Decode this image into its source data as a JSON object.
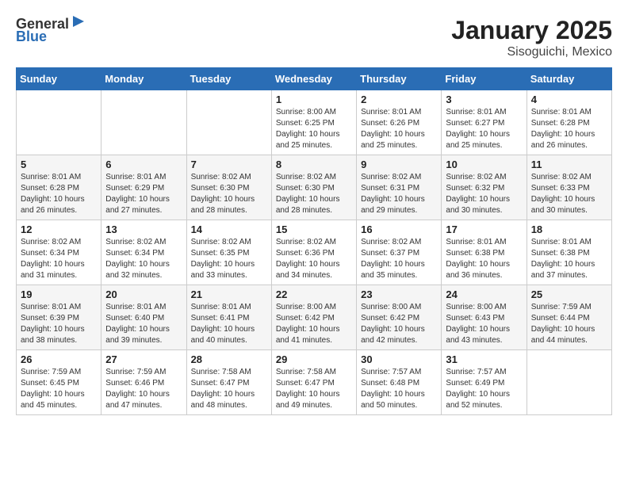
{
  "header": {
    "logo_line1": "General",
    "logo_line2": "Blue",
    "title": "January 2025",
    "subtitle": "Sisoguichi, Mexico"
  },
  "days_of_week": [
    "Sunday",
    "Monday",
    "Tuesday",
    "Wednesday",
    "Thursday",
    "Friday",
    "Saturday"
  ],
  "weeks": [
    [
      {
        "day": "",
        "info": ""
      },
      {
        "day": "",
        "info": ""
      },
      {
        "day": "",
        "info": ""
      },
      {
        "day": "1",
        "info": "Sunrise: 8:00 AM\nSunset: 6:25 PM\nDaylight: 10 hours\nand 25 minutes."
      },
      {
        "day": "2",
        "info": "Sunrise: 8:01 AM\nSunset: 6:26 PM\nDaylight: 10 hours\nand 25 minutes."
      },
      {
        "day": "3",
        "info": "Sunrise: 8:01 AM\nSunset: 6:27 PM\nDaylight: 10 hours\nand 25 minutes."
      },
      {
        "day": "4",
        "info": "Sunrise: 8:01 AM\nSunset: 6:28 PM\nDaylight: 10 hours\nand 26 minutes."
      }
    ],
    [
      {
        "day": "5",
        "info": "Sunrise: 8:01 AM\nSunset: 6:28 PM\nDaylight: 10 hours\nand 26 minutes."
      },
      {
        "day": "6",
        "info": "Sunrise: 8:01 AM\nSunset: 6:29 PM\nDaylight: 10 hours\nand 27 minutes."
      },
      {
        "day": "7",
        "info": "Sunrise: 8:02 AM\nSunset: 6:30 PM\nDaylight: 10 hours\nand 28 minutes."
      },
      {
        "day": "8",
        "info": "Sunrise: 8:02 AM\nSunset: 6:30 PM\nDaylight: 10 hours\nand 28 minutes."
      },
      {
        "day": "9",
        "info": "Sunrise: 8:02 AM\nSunset: 6:31 PM\nDaylight: 10 hours\nand 29 minutes."
      },
      {
        "day": "10",
        "info": "Sunrise: 8:02 AM\nSunset: 6:32 PM\nDaylight: 10 hours\nand 30 minutes."
      },
      {
        "day": "11",
        "info": "Sunrise: 8:02 AM\nSunset: 6:33 PM\nDaylight: 10 hours\nand 30 minutes."
      }
    ],
    [
      {
        "day": "12",
        "info": "Sunrise: 8:02 AM\nSunset: 6:34 PM\nDaylight: 10 hours\nand 31 minutes."
      },
      {
        "day": "13",
        "info": "Sunrise: 8:02 AM\nSunset: 6:34 PM\nDaylight: 10 hours\nand 32 minutes."
      },
      {
        "day": "14",
        "info": "Sunrise: 8:02 AM\nSunset: 6:35 PM\nDaylight: 10 hours\nand 33 minutes."
      },
      {
        "day": "15",
        "info": "Sunrise: 8:02 AM\nSunset: 6:36 PM\nDaylight: 10 hours\nand 34 minutes."
      },
      {
        "day": "16",
        "info": "Sunrise: 8:02 AM\nSunset: 6:37 PM\nDaylight: 10 hours\nand 35 minutes."
      },
      {
        "day": "17",
        "info": "Sunrise: 8:01 AM\nSunset: 6:38 PM\nDaylight: 10 hours\nand 36 minutes."
      },
      {
        "day": "18",
        "info": "Sunrise: 8:01 AM\nSunset: 6:38 PM\nDaylight: 10 hours\nand 37 minutes."
      }
    ],
    [
      {
        "day": "19",
        "info": "Sunrise: 8:01 AM\nSunset: 6:39 PM\nDaylight: 10 hours\nand 38 minutes."
      },
      {
        "day": "20",
        "info": "Sunrise: 8:01 AM\nSunset: 6:40 PM\nDaylight: 10 hours\nand 39 minutes."
      },
      {
        "day": "21",
        "info": "Sunrise: 8:01 AM\nSunset: 6:41 PM\nDaylight: 10 hours\nand 40 minutes."
      },
      {
        "day": "22",
        "info": "Sunrise: 8:00 AM\nSunset: 6:42 PM\nDaylight: 10 hours\nand 41 minutes."
      },
      {
        "day": "23",
        "info": "Sunrise: 8:00 AM\nSunset: 6:42 PM\nDaylight: 10 hours\nand 42 minutes."
      },
      {
        "day": "24",
        "info": "Sunrise: 8:00 AM\nSunset: 6:43 PM\nDaylight: 10 hours\nand 43 minutes."
      },
      {
        "day": "25",
        "info": "Sunrise: 7:59 AM\nSunset: 6:44 PM\nDaylight: 10 hours\nand 44 minutes."
      }
    ],
    [
      {
        "day": "26",
        "info": "Sunrise: 7:59 AM\nSunset: 6:45 PM\nDaylight: 10 hours\nand 45 minutes."
      },
      {
        "day": "27",
        "info": "Sunrise: 7:59 AM\nSunset: 6:46 PM\nDaylight: 10 hours\nand 47 minutes."
      },
      {
        "day": "28",
        "info": "Sunrise: 7:58 AM\nSunset: 6:47 PM\nDaylight: 10 hours\nand 48 minutes."
      },
      {
        "day": "29",
        "info": "Sunrise: 7:58 AM\nSunset: 6:47 PM\nDaylight: 10 hours\nand 49 minutes."
      },
      {
        "day": "30",
        "info": "Sunrise: 7:57 AM\nSunset: 6:48 PM\nDaylight: 10 hours\nand 50 minutes."
      },
      {
        "day": "31",
        "info": "Sunrise: 7:57 AM\nSunset: 6:49 PM\nDaylight: 10 hours\nand 52 minutes."
      },
      {
        "day": "",
        "info": ""
      }
    ]
  ]
}
